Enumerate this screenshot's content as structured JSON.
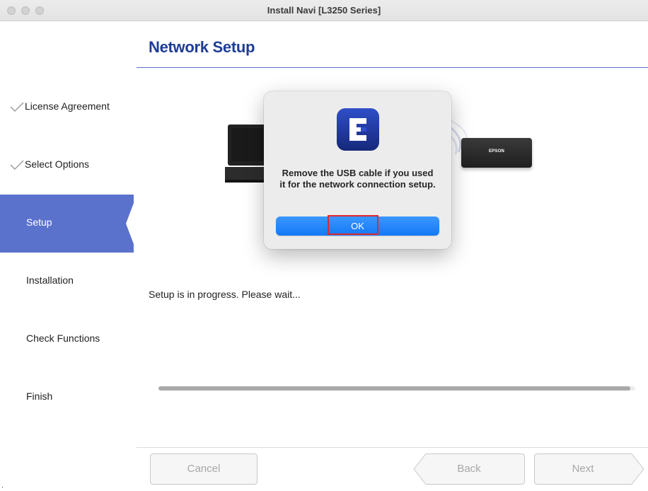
{
  "window": {
    "title": "Install Navi [L3250 Series]"
  },
  "header": {
    "title": "Network Setup",
    "accent_color": "#1d3d96"
  },
  "sidebar": {
    "active_color": "#5b72cc",
    "steps": [
      {
        "label": "License Agreement",
        "state": "done",
        "icon": "checkmark-icon"
      },
      {
        "label": "Select Options",
        "state": "done",
        "icon": "checkmark-icon"
      },
      {
        "label": "Setup",
        "state": "active"
      },
      {
        "label": "Installation",
        "state": "pending"
      },
      {
        "label": "Check Functions",
        "state": "pending"
      },
      {
        "label": "Finish",
        "state": "pending"
      }
    ]
  },
  "illustration": {
    "printer_brand": "EPSON",
    "icons": [
      "laptop-icon",
      "wifi-waves-icon",
      "printer-icon"
    ]
  },
  "dialog": {
    "icon": "epson-app-icon",
    "message": "Remove the USB cable if you used it for the network connection setup.",
    "ok_label": "OK",
    "ok_color": "#1479f6",
    "highlight_color": "#e0282e"
  },
  "status": {
    "text": "Setup is in progress. Please wait...",
    "progress": 0.99
  },
  "footer": {
    "cancel_label": "Cancel",
    "back_label": "Back",
    "next_label": "Next"
  }
}
